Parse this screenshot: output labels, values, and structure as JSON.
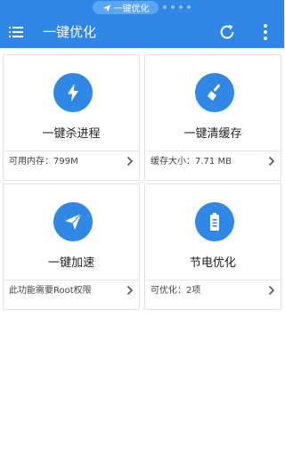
{
  "status_bar": {
    "pill_label": "一键优化",
    "pill_icon": "paper-plane-icon"
  },
  "app_bar": {
    "title": "一键优化",
    "menu_icon": "menu-icon",
    "refresh_icon": "refresh-icon",
    "more_icon": "more-vertical-icon"
  },
  "colors": {
    "primary": "#2f86e4",
    "icon_circle": "#2f88e6"
  },
  "cards": [
    {
      "icon": "lightning-icon",
      "title": "一键杀进程",
      "footer": "可用内存：799M"
    },
    {
      "icon": "broom-icon",
      "title": "一键清缓存",
      "footer": "缓存大小：7.71 MB"
    },
    {
      "icon": "paper-plane-icon",
      "title": "一键加速",
      "footer": "此功能需要Root权限"
    },
    {
      "icon": "battery-icon",
      "title": "节电优化",
      "footer": "可优化：2项"
    }
  ]
}
